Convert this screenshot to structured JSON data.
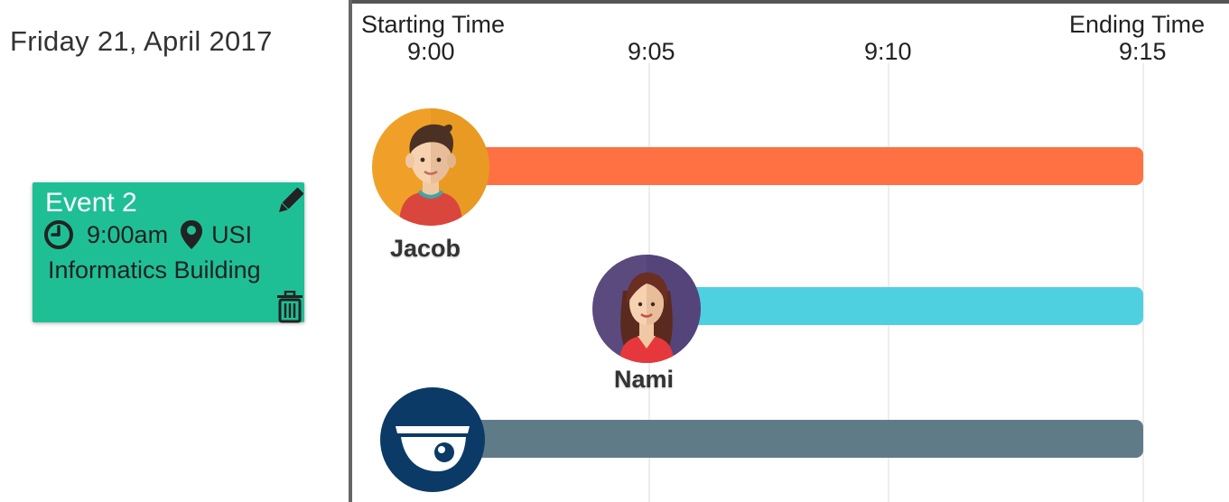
{
  "date": "Friday 21, April 2017",
  "event": {
    "title": "Event 2",
    "time": "9:00am",
    "location": "USI",
    "building": "Informatics Building"
  },
  "timeline": {
    "start_label": "Starting Time",
    "end_label": "Ending Time",
    "ticks": [
      "9:00",
      "9:05",
      "9:10",
      "9:15"
    ]
  },
  "participants": [
    {
      "name": "Jacob",
      "start": "9:00",
      "end": "9:15",
      "color": "#ff7043"
    },
    {
      "name": "Nami",
      "start": "9:05",
      "end": "9:15",
      "color": "#4fd0e0"
    },
    {
      "name": "",
      "start": "9:00",
      "end": "9:15",
      "color": "#607b88",
      "icon": "camera-icon"
    }
  ],
  "colors": {
    "card": "#1fbf96",
    "jacob_avatar": "#f0a028",
    "nami_avatar": "#5b4a7e",
    "camera_avatar": "#0b3a66"
  }
}
